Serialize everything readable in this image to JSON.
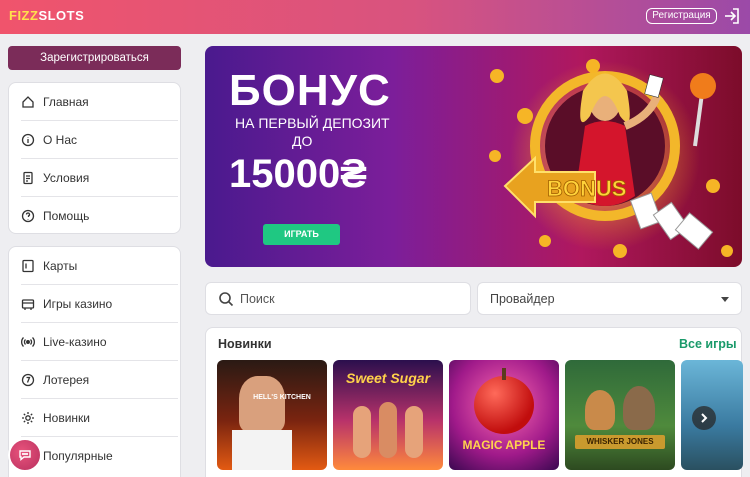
{
  "brand": {
    "logo_part1": "FIZZ",
    "logo_part2": "SLOTS"
  },
  "header": {
    "register_label": "Регистрация",
    "login_icon": "login-icon"
  },
  "sidebar": {
    "register_button": "Зарегистрироваться",
    "group1": [
      {
        "label": "Главная",
        "icon": "home-icon"
      },
      {
        "label": "О Нас",
        "icon": "info-icon"
      },
      {
        "label": "Условия",
        "icon": "document-icon"
      },
      {
        "label": "Помощь",
        "icon": "help-icon"
      }
    ],
    "group2": [
      {
        "label": "Карты",
        "icon": "cards-icon"
      },
      {
        "label": "Игры казино",
        "icon": "casino-icon"
      },
      {
        "label": "Live-казино",
        "icon": "live-icon"
      },
      {
        "label": "Лотерея",
        "icon": "lottery-icon"
      },
      {
        "label": "Новинки",
        "icon": "new-icon"
      },
      {
        "label": "Популярные",
        "icon": "popular-icon"
      }
    ]
  },
  "banner": {
    "title": "БОНУС",
    "subtitle1": "НА ПЕРВЫЙ ДЕПОЗИТ",
    "subtitle2": "ДО",
    "amount": "15000₴",
    "play_button": "ИГРАТЬ",
    "sign_text": "BONUS"
  },
  "filters": {
    "search_placeholder": "Поиск",
    "provider_label": "Провайдер"
  },
  "games": {
    "section_title": "Новинки",
    "all_games_link": "Все игры",
    "tiles": [
      {
        "name": "HELL'S KITCHEN"
      },
      {
        "name": "Sweet Sugar"
      },
      {
        "name": "MAGIC APPLE"
      },
      {
        "name": "WHISKER JONES"
      },
      {
        "name": ""
      }
    ]
  },
  "colors": {
    "accent": "#7b2c59",
    "play": "#1fc882",
    "link": "#1a9a6a"
  }
}
